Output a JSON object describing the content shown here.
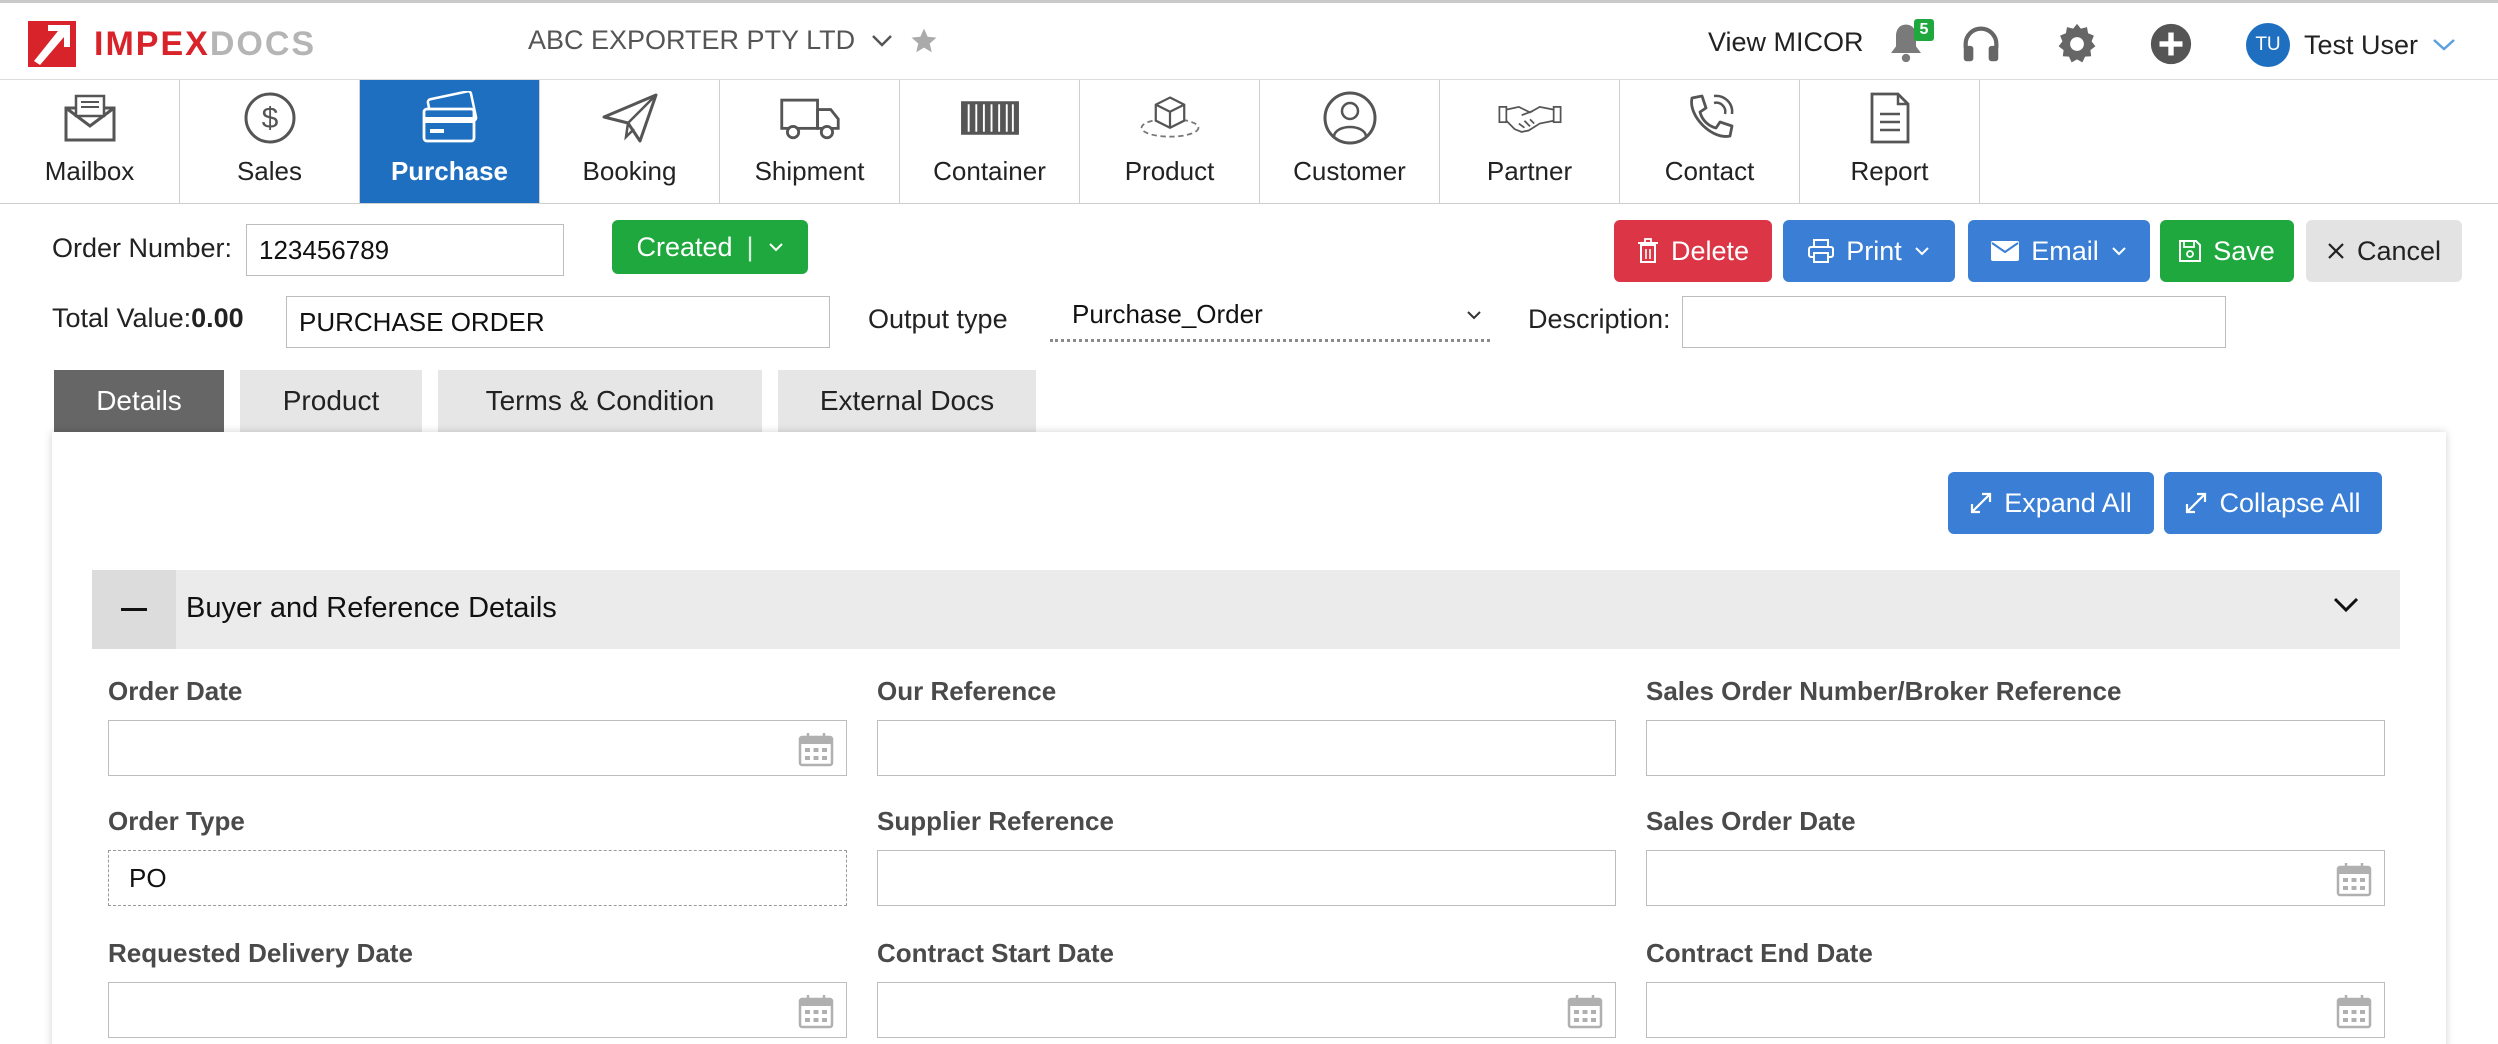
{
  "brand": {
    "name_part1": "IMPEX",
    "name_part2": "DOCS",
    "accent": "#d8232a"
  },
  "header": {
    "company": "ABC EXPORTER PTY LTD",
    "view_micor": "View MICOR",
    "notification_count": "5",
    "user_initials": "TU",
    "user_name": "Test User"
  },
  "modules": [
    {
      "label": "Mailbox",
      "icon": "mailbox-icon"
    },
    {
      "label": "Sales",
      "icon": "dollar-icon"
    },
    {
      "label": "Purchase",
      "icon": "credit-card-icon",
      "active": true
    },
    {
      "label": "Booking",
      "icon": "paper-plane-icon"
    },
    {
      "label": "Shipment",
      "icon": "truck-icon"
    },
    {
      "label": "Container",
      "icon": "container-icon"
    },
    {
      "label": "Product",
      "icon": "box-icon"
    },
    {
      "label": "Customer",
      "icon": "person-icon"
    },
    {
      "label": "Partner",
      "icon": "handshake-icon"
    },
    {
      "label": "Contact",
      "icon": "phone-icon"
    },
    {
      "label": "Report",
      "icon": "document-icon"
    }
  ],
  "order": {
    "number_label": "Order Number:",
    "number_value": "123456789",
    "status": "Created",
    "total_label": "Total Value:",
    "total_value": "0.00",
    "doc_title": "PURCHASE ORDER",
    "output_type_label": "Output type",
    "output_type_value": "Purchase_Order",
    "description_label": "Description:",
    "description_value": ""
  },
  "actions": {
    "delete": "Delete",
    "print": "Print",
    "email": "Email",
    "save": "Save",
    "cancel": "Cancel"
  },
  "tabs": [
    "Details",
    "Product",
    "Terms & Condition",
    "External Docs"
  ],
  "panel": {
    "expand_all": "Expand All",
    "collapse_all": "Collapse All",
    "section_title": "Buyer and Reference Details"
  },
  "fields": {
    "order_date": {
      "label": "Order Date",
      "value": ""
    },
    "our_reference": {
      "label": "Our Reference",
      "value": ""
    },
    "sales_order_number": {
      "label": "Sales Order Number/Broker Reference",
      "value": ""
    },
    "order_type": {
      "label": "Order Type",
      "value": "PO"
    },
    "supplier_reference": {
      "label": "Supplier Reference",
      "value": ""
    },
    "sales_order_date": {
      "label": "Sales Order Date",
      "value": ""
    },
    "requested_delivery_date": {
      "label": "Requested Delivery Date",
      "value": ""
    },
    "contract_start_date": {
      "label": "Contract Start Date",
      "value": ""
    },
    "contract_end_date": {
      "label": "Contract End Date",
      "value": ""
    }
  },
  "colors": {
    "primary_blue": "#1f6fc0",
    "button_blue": "#3a7fd5",
    "green": "#1ea83e",
    "red": "#dc3545"
  }
}
